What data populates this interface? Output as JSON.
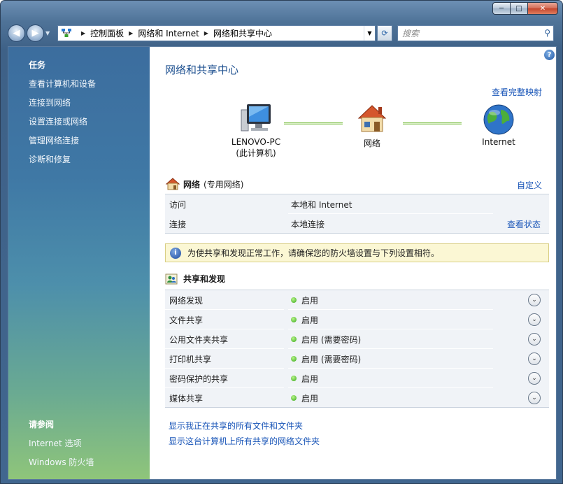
{
  "window": {
    "caption": {
      "minimize": "─",
      "maximize": "□",
      "close": "✕"
    }
  },
  "navbar": {
    "back_glyph": "◀",
    "forward_glyph": "▶",
    "breadcrumbs": [
      "控制面板",
      "网络和 Internet",
      "网络和共享中心"
    ],
    "separator": "▶",
    "search_placeholder": "搜索",
    "dropdown_glyph": "▼",
    "refresh_glyph": "⟳",
    "search_glyph": "⚲"
  },
  "sidebar": {
    "tasks_title": "任务",
    "tasks": [
      "查看计算机和设备",
      "连接到网络",
      "设置连接或网络",
      "管理网络连接",
      "诊断和修复"
    ],
    "see_also_title": "请参阅",
    "see_also": [
      "Internet 选项",
      "Windows 防火墙"
    ]
  },
  "main": {
    "help_glyph": "?",
    "title": "网络和共享中心",
    "view_full_map": "查看完整映射",
    "map": {
      "computer": {
        "line1": "LENOVO-PC",
        "line2": "(此计算机)"
      },
      "network": "网络",
      "internet": "Internet"
    },
    "network_section": {
      "name": "网络",
      "type": "(专用网络)",
      "customize": "自定义",
      "rows": [
        {
          "key": "访问",
          "value": "本地和 Internet",
          "action": ""
        },
        {
          "key": "连接",
          "value": "本地连接",
          "action": "查看状态"
        }
      ]
    },
    "notice": {
      "icon": "i",
      "text": "为使共享和发现正常工作，请确保您的防火墙设置与下列设置相符。"
    },
    "sharing_section": {
      "title": "共享和发现",
      "expand_glyph": "⌄",
      "rows": [
        {
          "key": "网络发现",
          "value": "启用"
        },
        {
          "key": "文件共享",
          "value": "启用"
        },
        {
          "key": "公用文件夹共享",
          "value": "启用 (需要密码)"
        },
        {
          "key": "打印机共享",
          "value": "启用 (需要密码)"
        },
        {
          "key": "密码保护的共享",
          "value": "启用"
        },
        {
          "key": "媒体共享",
          "value": "启用"
        }
      ]
    },
    "links": [
      "显示我正在共享的所有文件和文件夹",
      "显示这台计算机上所有共享的网络文件夹"
    ]
  },
  "colors": {
    "link": "#1a56b8",
    "title": "#1c4f8f",
    "status_green": "#36a81a",
    "notice_bg": "#fbf7d4"
  }
}
